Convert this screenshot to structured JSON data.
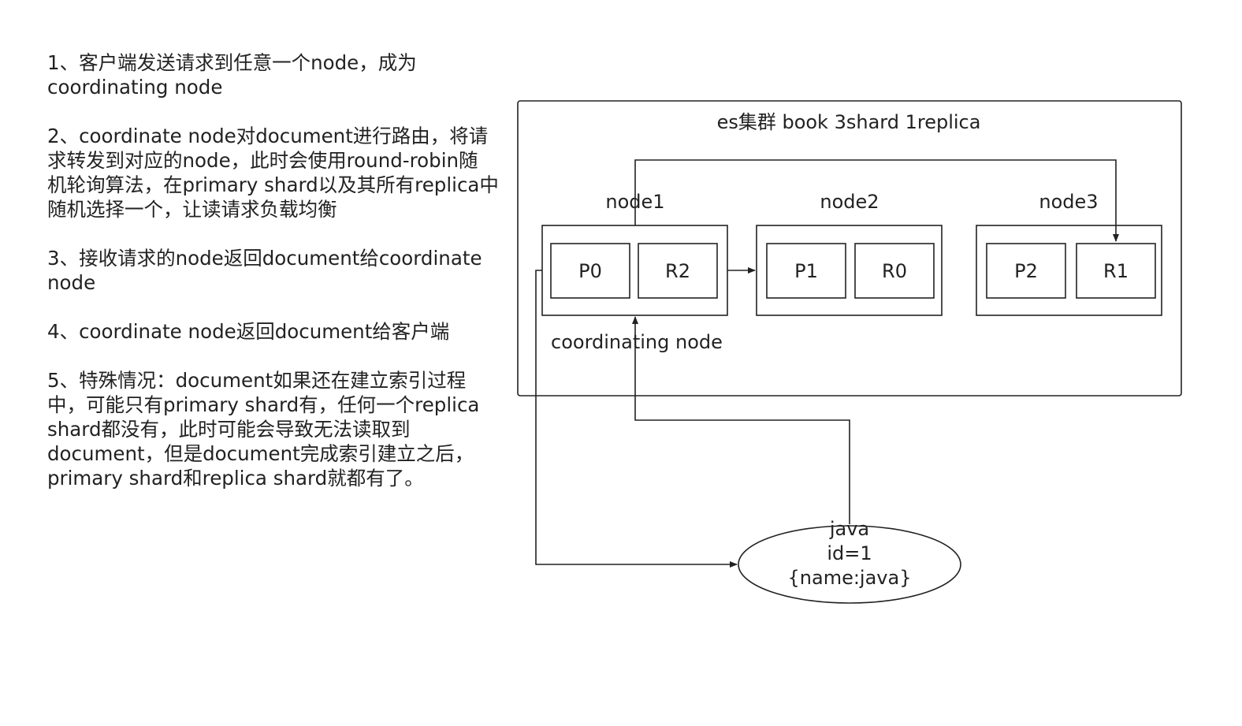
{
  "steps": [
    "1、客户端发送请求到任意一个node，成为\ncoordinating node",
    "2、coordinate node对document进行路由，将请\n求转发到对应的node，此时会使用round-robin随\n机轮询算法，在primary shard以及其所有replica中\n随机选择一个，让读请求负载均衡",
    "3、接收请求的node返回document给coordinate\nnode",
    "4、coordinate node返回document给客户端",
    "5、特殊情况：document如果还在建立索引过程\n中，可能只有primary shard有，任何一个replica\nshard都没有，此时可能会导致无法读取到\ndocument，但是document完成索引建立之后，\nprimary shard和replica shard就都有了。"
  ],
  "cluster": {
    "title": "es集群 book 3shard 1replica",
    "nodes": [
      {
        "label": "node1",
        "shards": [
          "P0",
          "R2"
        ]
      },
      {
        "label": "node2",
        "shards": [
          "P1",
          "R0"
        ]
      },
      {
        "label": "node3",
        "shards": [
          "P2",
          "R1"
        ]
      }
    ],
    "coordinating_label": "coordinating node"
  },
  "client": {
    "lines": [
      "java",
      "id=1",
      "{name:java}"
    ]
  }
}
